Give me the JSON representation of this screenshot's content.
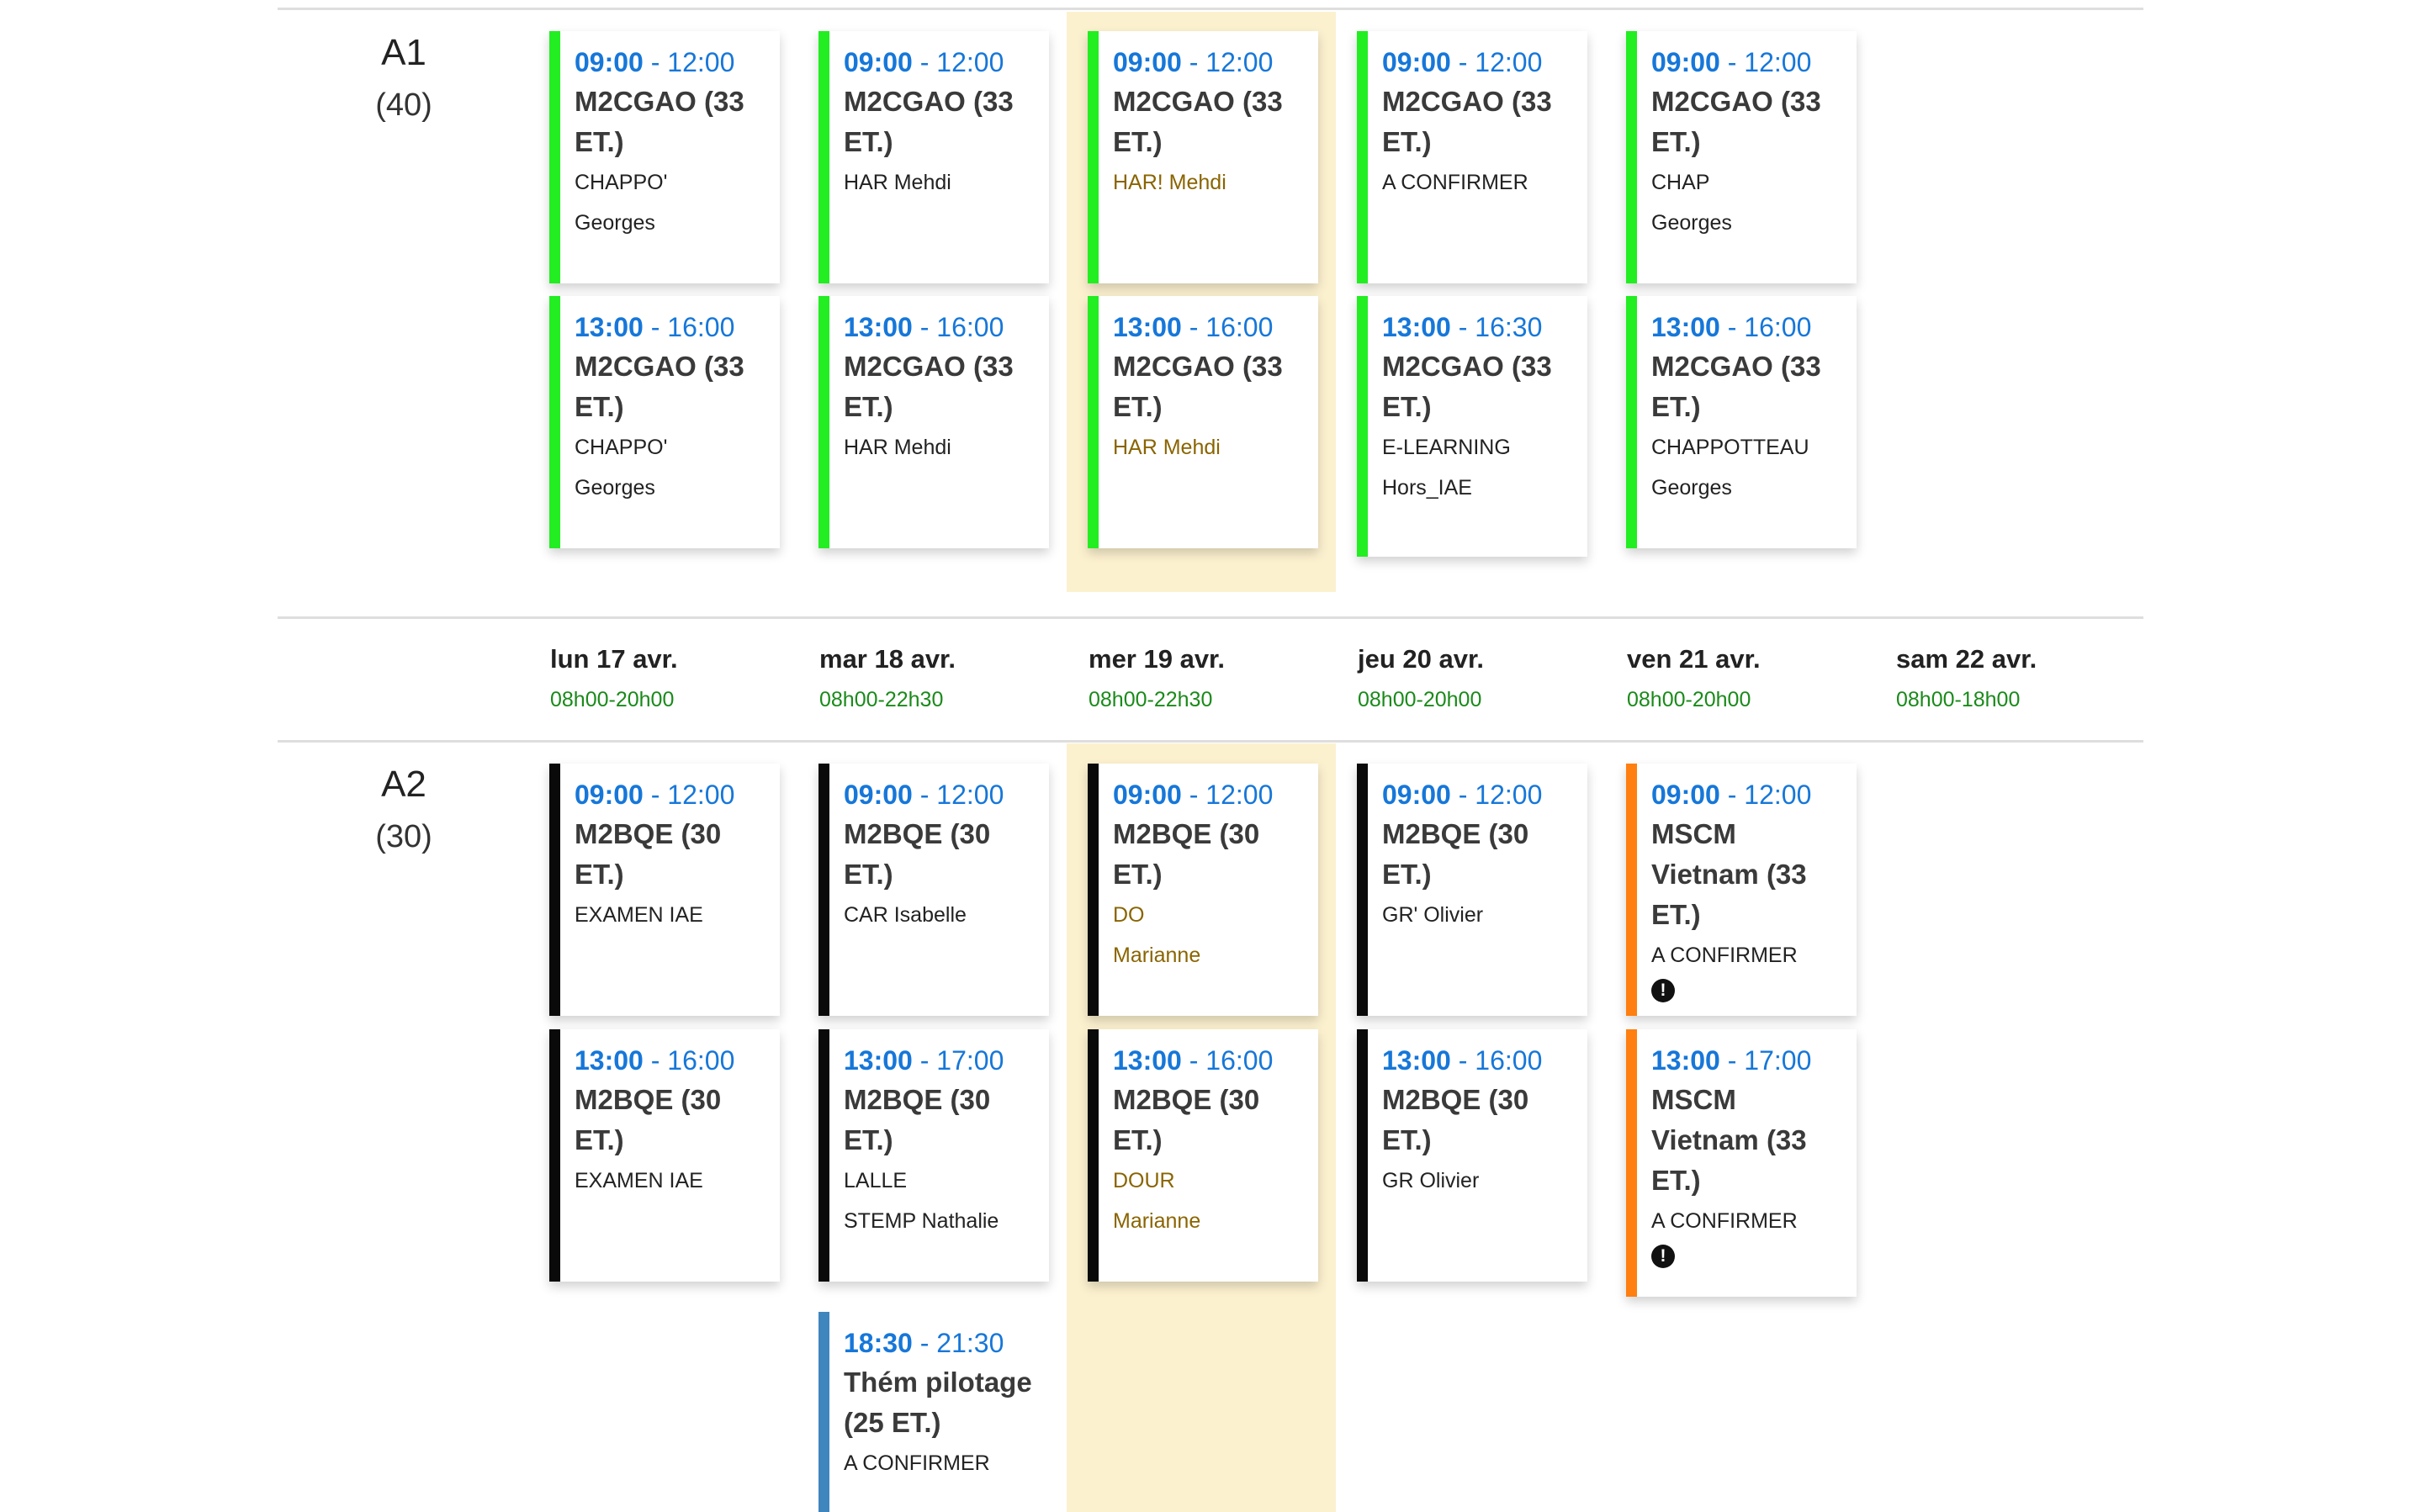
{
  "colors": {
    "green": "#22ee22",
    "black": "#0a0a0a",
    "orange": "#ff7f10",
    "blue": "#3f86bf",
    "today_bg": "#fcf1cf",
    "time": "#1677d9",
    "hours": "#1a8a1a"
  },
  "rooms": {
    "A1": {
      "name": "A1",
      "capacity": "(40)"
    },
    "A2": {
      "name": "A2",
      "capacity": "(30)"
    }
  },
  "days": [
    {
      "label": "lun 17 avr.",
      "hours": "08h00-20h00"
    },
    {
      "label": "mar 18 avr.",
      "hours": "08h00-22h30"
    },
    {
      "label": "mer 19 avr.",
      "hours": "08h00-22h30"
    },
    {
      "label": "jeu 20 avr.",
      "hours": "08h00-20h00"
    },
    {
      "label": "ven 21 avr.",
      "hours": "08h00-20h00"
    },
    {
      "label": "sam 22 avr.",
      "hours": "08h00-18h00"
    }
  ],
  "events": {
    "a1": [
      {
        "start": "09:00",
        "end": "12:00",
        "title": "M2CGAO (33 ET.)",
        "lines": [
          "CHAPPO'",
          "Georges"
        ],
        "color": "green"
      },
      {
        "start": "13:00",
        "end": "16:00",
        "title": "M2CGAO (33 ET.)",
        "lines": [
          "CHAPPO'",
          "Georges"
        ],
        "color": "green"
      },
      {
        "start": "09:00",
        "end": "12:00",
        "title": "M2CGAO (33 ET.)",
        "lines": [
          "HAR     Mehdi"
        ],
        "color": "green"
      },
      {
        "start": "13:00",
        "end": "16:00",
        "title": "M2CGAO (33 ET.)",
        "lines": [
          "HAR     Mehdi"
        ],
        "color": "green"
      },
      {
        "start": "09:00",
        "end": "12:00",
        "title": "M2CGAO (33 ET.)",
        "lines": [
          "HAR!    Mehdi"
        ],
        "color": "green"
      },
      {
        "start": "13:00",
        "end": "16:00",
        "title": "M2CGAO (33 ET.)",
        "lines": [
          "HAR     Mehdi"
        ],
        "color": "green"
      },
      {
        "start": "09:00",
        "end": "12:00",
        "title": "M2CGAO (33 ET.)",
        "lines": [
          "A CONFIRMER"
        ],
        "color": "green"
      },
      {
        "start": "13:00",
        "end": "16:30",
        "title": "M2CGAO (33 ET.)",
        "lines": [
          "E-LEARNING",
          "Hors_IAE"
        ],
        "color": "green"
      },
      {
        "start": "09:00",
        "end": "12:00",
        "title": "M2CGAO (33 ET.)",
        "lines": [
          "CHAP",
          "Georges"
        ],
        "color": "green"
      },
      {
        "start": "13:00",
        "end": "16:00",
        "title": "M2CGAO (33 ET.)",
        "lines": [
          "CHAPPOTTEAU",
          "Georges"
        ],
        "color": "green"
      }
    ],
    "a2": [
      {
        "start": "09:00",
        "end": "12:00",
        "title": "M2BQE (30 ET.)",
        "lines": [
          "EXAMEN IAE"
        ],
        "color": "black"
      },
      {
        "start": "13:00",
        "end": "16:00",
        "title": "M2BQE (30 ET.)",
        "lines": [
          "EXAMEN IAE"
        ],
        "color": "black"
      },
      {
        "start": "09:00",
        "end": "12:00",
        "title": "M2BQE (30 ET.)",
        "lines": [
          "CAR       Isabelle"
        ],
        "color": "black"
      },
      {
        "start": "13:00",
        "end": "17:00",
        "title": "M2BQE (30 ET.)",
        "lines": [
          "LALLE",
          "STEMP     Nathalie"
        ],
        "color": "black"
      },
      {
        "start": "18:30",
        "end": "21:30",
        "title": "Thém pilotage (25 ET.)",
        "lines": [
          "A CONFIRMER"
        ],
        "color": "blue"
      },
      {
        "start": "09:00",
        "end": "12:00",
        "title": "M2BQE (30 ET.)",
        "lines": [
          "DO",
          "Marianne"
        ],
        "color": "black"
      },
      {
        "start": "13:00",
        "end": "16:00",
        "title": "M2BQE (30 ET.)",
        "lines": [
          "DOUR",
          "Marianne"
        ],
        "color": "black"
      },
      {
        "start": "09:00",
        "end": "12:00",
        "title": "M2BQE (30 ET.)",
        "lines": [
          "GR'     Olivier"
        ],
        "color": "black"
      },
      {
        "start": "13:00",
        "end": "16:00",
        "title": "M2BQE (30 ET.)",
        "lines": [
          "GR      Olivier"
        ],
        "color": "black"
      },
      {
        "start": "09:00",
        "end": "12:00",
        "title": "MSCM Vietnam (33 ET.)",
        "lines": [
          "A CONFIRMER"
        ],
        "color": "orange",
        "warning": "!"
      },
      {
        "start": "13:00",
        "end": "17:00",
        "title": "MSCM Vietnam (33 ET.)",
        "lines": [
          "A CONFIRMER"
        ],
        "color": "orange",
        "warning": "!"
      }
    ]
  }
}
